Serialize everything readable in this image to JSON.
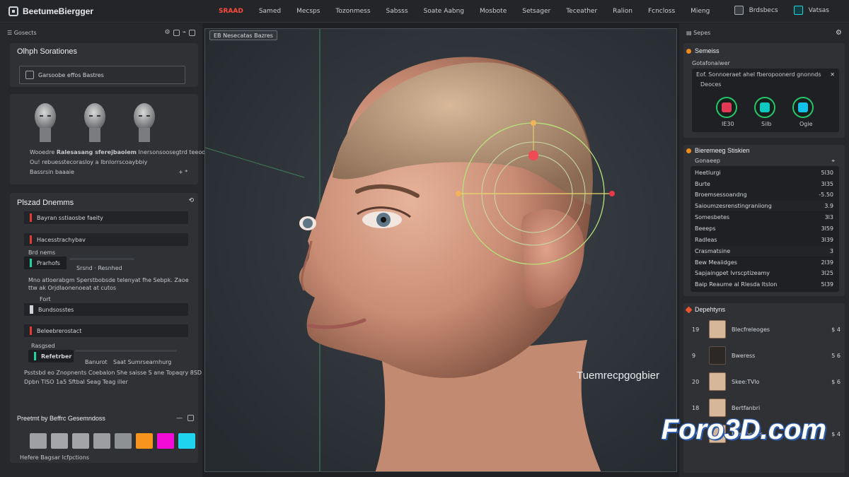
{
  "app": {
    "title": "BeetumeBiergger",
    "menu": [
      "SRAAD",
      "Samed",
      "Mecsps",
      "Tozonmess",
      "Sabsss",
      "Soate Aabng",
      "Mosbote",
      "Setsager",
      "Teceather",
      "Ralion",
      "Fcncloss",
      "Mieng"
    ],
    "top_right": {
      "label1": "Brdsbecs",
      "label2": "Vatsas"
    }
  },
  "left": {
    "header": "Gosects",
    "orig_card": {
      "title": "Olhph Sorationes",
      "input_value": "Garsoobe effos Bastres"
    },
    "heads_card": {
      "line1_a": "Wooedre",
      "line1_b": "Ralesasang sferejbaoiem",
      "line1_c": "Inersonsoosegtrd teeodelep",
      "line2": "Ou! rebuesstecorasloy a Ibnlorrscoaybbiy",
      "line3": "Bassrsin baaaie",
      "plus_label": "+ *"
    },
    "detail_card": {
      "title": "Plszad Dnemms",
      "item1": "Bayran sstiaosbe faeity",
      "item2": "Hacesstrachybav",
      "label_a": "Brd nems",
      "toggle_label": "Prarhofs",
      "slider_label": "Srsnd · Resnhed",
      "desc": "Mno atloerabgm Sperstbobsde telenyat fhe Sebpk. Zaoe ttw ak Orjdlaonenoeat at cutos",
      "label_b": "Fort",
      "item3": "Bundsosstes",
      "item4": "Beleebrerostact",
      "label_c": "Rasgsed",
      "toggle2_label": "Refetrber",
      "slider2_a": "Banurot",
      "slider2_b": "Saat  Sumrsearnhurg",
      "foot1": "Psstsbd eo Znopnents Coebalon She saisse S ane Topaqry 8SD",
      "foot2": "Dpbn TISO 1a5 Sftbal Seag Teag ilier"
    },
    "palette": {
      "title": "Preetmt by Beffrc Gesemndoss",
      "footer": "Hefere Bagsar lcfpctions",
      "colors": [
        "#9ea0a3",
        "#a4a6a9",
        "#a2a4a7",
        "#9c9ea1",
        "#8e9194",
        "#f7941d",
        "#f20bd6",
        "#1ed4ef"
      ]
    }
  },
  "viewport": {
    "tab": "EB Nesecatas Bazres",
    "overlay_text": "Tuemrecpgogbier",
    "watermark": "Foro3D.com"
  },
  "right": {
    "header": "Sepes",
    "section1": {
      "title": "Semeiss",
      "sub": "Gotafonaiwer",
      "box_label": "Eof. Sonnoeraet ahel fberopoonerd gnonnds",
      "box_sub": "Deoces",
      "buttons": [
        "IE30",
        "Silb",
        "Ogie"
      ]
    },
    "section2": {
      "title": "Bieremeeg Stiskien",
      "sub": "Gonaeep",
      "rows": [
        {
          "name": "Heetlurgi",
          "value": "5l30"
        },
        {
          "name": "Burte",
          "value": "3l35"
        },
        {
          "name": "Broemsessoandng",
          "value": "-5.50"
        },
        {
          "name": "Saioumzesrenstingraniiong",
          "value": "3.9"
        },
        {
          "name": "Somesbetes",
          "value": "3l3"
        },
        {
          "name": "Beeeps",
          "value": "3l59"
        },
        {
          "name": "Radleas",
          "value": "3l39"
        },
        {
          "name": "Crasmatsine",
          "value": "3"
        },
        {
          "name": "Bew Meaiidges",
          "value": "2l39"
        },
        {
          "name": "Sapjaingpet lvrscptizeamy",
          "value": "3l25"
        },
        {
          "name": "Baip Reaume al Rlesda ltslon",
          "value": "5l39"
        }
      ]
    },
    "section3": {
      "title": "Depehtyns",
      "rows": [
        {
          "num": "19",
          "name": "Blecfreleoges",
          "value": "$ 4"
        },
        {
          "num": "9",
          "name": "Bweress",
          "value": "5 6"
        },
        {
          "num": "20",
          "name": "Skee:TVlo",
          "value": "$ 6"
        },
        {
          "num": "18",
          "name": "Bertfanbri",
          "value": ""
        },
        {
          "num": "19",
          "name": "Bresioehas",
          "value": "$ 4"
        }
      ]
    }
  }
}
